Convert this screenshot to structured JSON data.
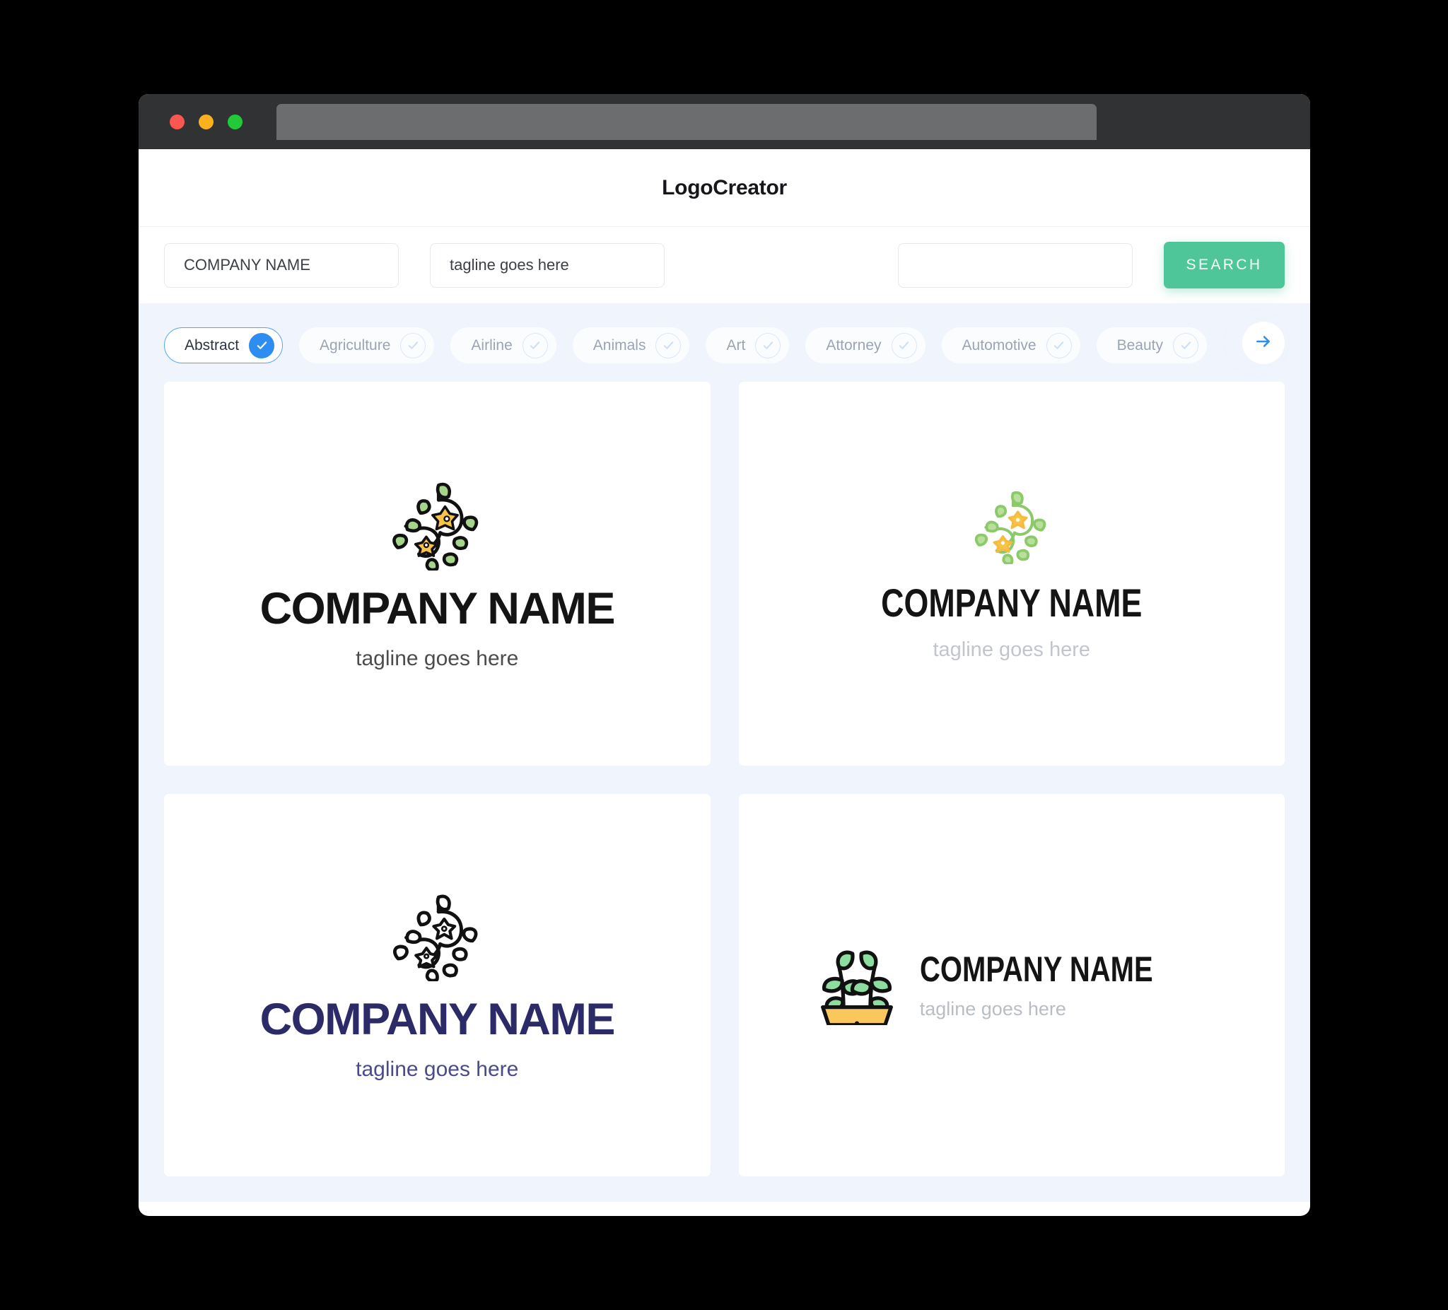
{
  "window": {
    "traffic_lights": [
      "close",
      "minimize",
      "maximize"
    ],
    "url_value": ""
  },
  "header": {
    "title": "LogoCreator"
  },
  "search": {
    "company_value": "COMPANY NAME",
    "company_placeholder": "COMPANY NAME",
    "tagline_value": "tagline goes here",
    "tagline_placeholder": "tagline goes here",
    "keyword_value": "",
    "keyword_placeholder": "",
    "button_label": "SEARCH",
    "button_color": "#4ec69a"
  },
  "categories": {
    "accent_color": "#2d8df0",
    "items": [
      {
        "label": "Abstract",
        "selected": true
      },
      {
        "label": "Agriculture",
        "selected": false
      },
      {
        "label": "Airline",
        "selected": false
      },
      {
        "label": "Animals",
        "selected": false
      },
      {
        "label": "Art",
        "selected": false
      },
      {
        "label": "Attorney",
        "selected": false
      },
      {
        "label": "Automotive",
        "selected": false
      },
      {
        "label": "Beauty",
        "selected": false
      }
    ],
    "next_icon": "arrow-right-icon"
  },
  "results": {
    "cards": [
      {
        "icon": "floral-vine-icon",
        "name": "COMPANY NAME",
        "tagline": "tagline goes here",
        "name_color": "#141414",
        "tagline_color": "#4c4c4c",
        "layout": "vertical"
      },
      {
        "icon": "floral-vine-icon",
        "name": "COMPANY NAME",
        "tagline": "tagline goes here",
        "name_color": "#141414",
        "tagline_color": "#c2c6cc",
        "layout": "vertical"
      },
      {
        "icon": "floral-vine-icon",
        "name": "COMPANY NAME",
        "tagline": "tagline goes here",
        "name_color": "#2d2a68",
        "tagline_color": "#4b4a8c",
        "layout": "vertical"
      },
      {
        "icon": "potted-plant-icon",
        "name": "COMPANY NAME",
        "tagline": "tagline goes here",
        "name_color": "#141414",
        "tagline_color": "#b9bdc4",
        "layout": "horizontal"
      }
    ]
  },
  "theme": {
    "page_background": "#000000",
    "app_background": "#eff4fd",
    "card_background": "#ffffff",
    "titlebar": "#303234"
  }
}
